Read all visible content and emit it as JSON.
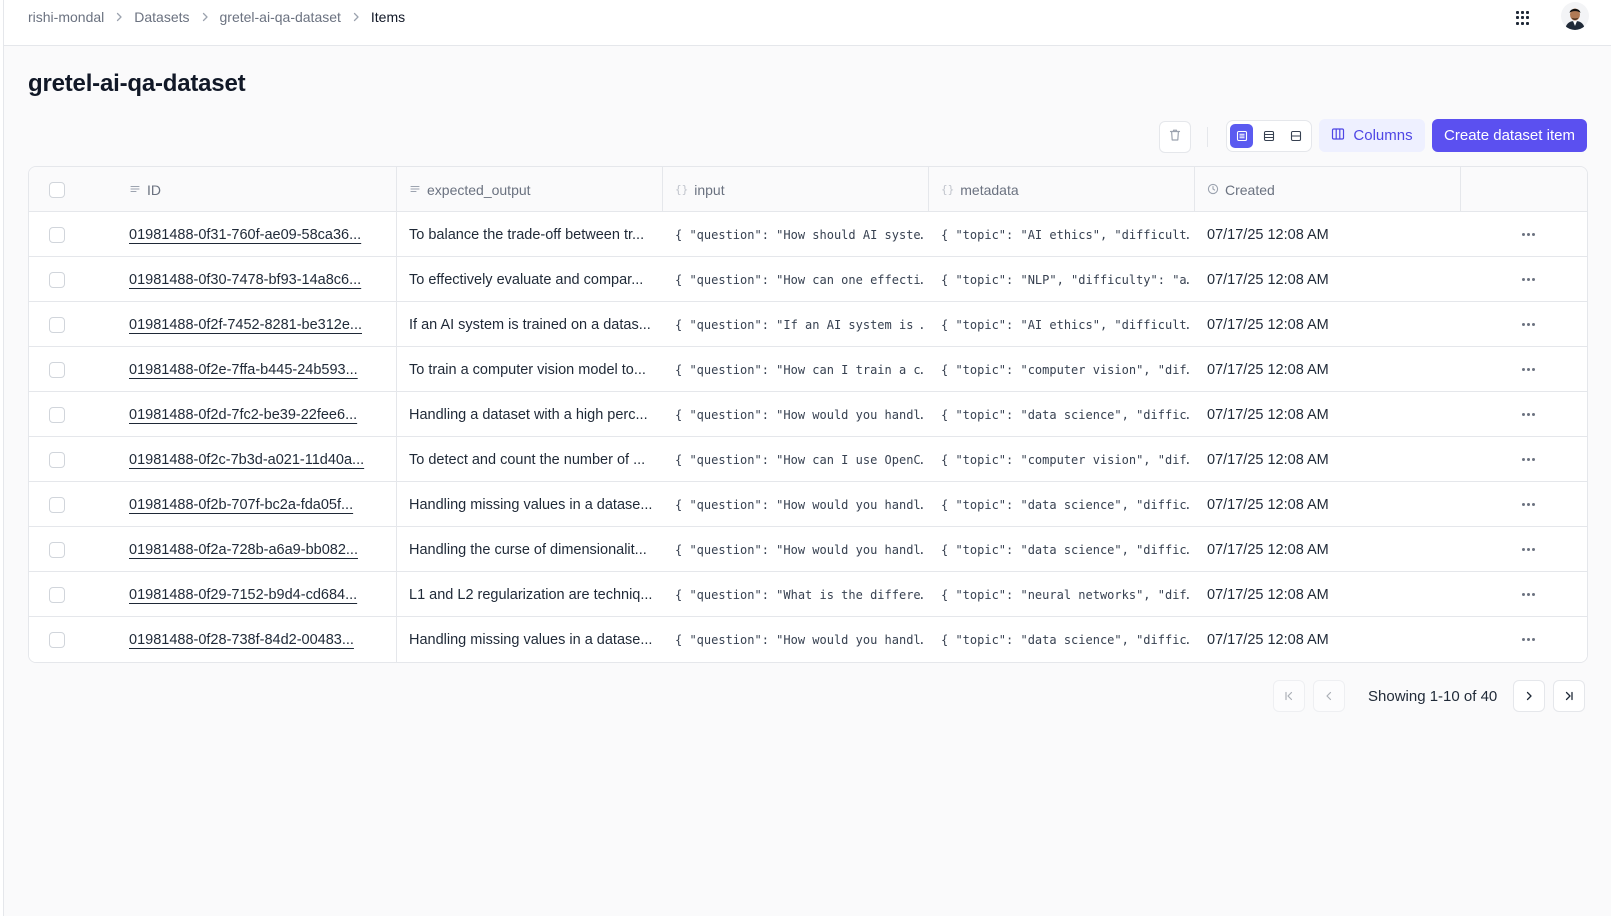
{
  "breadcrumb": {
    "items": [
      "rishi-mondal",
      "Datasets",
      "gretel-ai-qa-dataset",
      "Items"
    ]
  },
  "header": {
    "apps_icon": "grid-9-dots-icon",
    "avatar": "user-avatar"
  },
  "page": {
    "title": "gretel-ai-qa-dataset"
  },
  "toolbar": {
    "delete_icon": "trash-icon",
    "view_modes": [
      "rows-compact",
      "rows-medium",
      "rows-large"
    ],
    "active_view": "rows-compact",
    "columns_label": "Columns",
    "create_label": "Create dataset item"
  },
  "colors": {
    "accent": "#5b50f0",
    "accent_soft": "#eef0ff",
    "accent_text": "#4f46e5",
    "border": "#e5e7eb"
  },
  "table": {
    "headers": {
      "id": "ID",
      "expected_output": "expected_output",
      "input": "input",
      "metadata": "metadata",
      "created": "Created"
    },
    "rows": [
      {
        "id": "01981488-0f31-760f-ae09-58ca36...",
        "expected_output": "To balance the trade-off between tr...",
        "input": "{ \"question\": \"How should AI syste…",
        "metadata": "{ \"topic\": \"AI ethics\", \"difficult…",
        "created": "07/17/25 12:08 AM"
      },
      {
        "id": "01981488-0f30-7478-bf93-14a8c6...",
        "expected_output": "To effectively evaluate and compar...",
        "input": "{ \"question\": \"How can one effecti…",
        "metadata": "{ \"topic\": \"NLP\", \"difficulty\": \"a…",
        "created": "07/17/25 12:08 AM"
      },
      {
        "id": "01981488-0f2f-7452-8281-be312e...",
        "expected_output": "If an AI system is trained on a datas...",
        "input": "{ \"question\": \"If an AI system is …",
        "metadata": "{ \"topic\": \"AI ethics\", \"difficult…",
        "created": "07/17/25 12:08 AM"
      },
      {
        "id": "01981488-0f2e-7ffa-b445-24b593...",
        "expected_output": "To train a computer vision model to...",
        "input": "{ \"question\": \"How can I train a c…",
        "metadata": "{ \"topic\": \"computer vision\", \"dif…",
        "created": "07/17/25 12:08 AM"
      },
      {
        "id": "01981488-0f2d-7fc2-be39-22fee6...",
        "expected_output": "Handling a dataset with a high perc...",
        "input": "{ \"question\": \"How would you handl…",
        "metadata": "{ \"topic\": \"data science\", \"diffic…",
        "created": "07/17/25 12:08 AM"
      },
      {
        "id": "01981488-0f2c-7b3d-a021-11d40a...",
        "expected_output": "To detect and count the number of ...",
        "input": "{ \"question\": \"How can I use OpenC…",
        "metadata": "{ \"topic\": \"computer vision\", \"dif…",
        "created": "07/17/25 12:08 AM"
      },
      {
        "id": "01981488-0f2b-707f-bc2a-fda05f...",
        "expected_output": "Handling missing values in a datase...",
        "input": "{ \"question\": \"How would you handl…",
        "metadata": "{ \"topic\": \"data science\", \"diffic…",
        "created": "07/17/25 12:08 AM"
      },
      {
        "id": "01981488-0f2a-728b-a6a9-bb082...",
        "expected_output": "Handling the curse of dimensionalit...",
        "input": "{ \"question\": \"How would you handl…",
        "metadata": "{ \"topic\": \"data science\", \"diffic…",
        "created": "07/17/25 12:08 AM"
      },
      {
        "id": "01981488-0f29-7152-b9d4-cd684...",
        "expected_output": "L1 and L2 regularization are techniq...",
        "input": "{ \"question\": \"What is the differe…",
        "metadata": "{ \"topic\": \"neural networks\", \"dif…",
        "created": "07/17/25 12:08 AM"
      },
      {
        "id": "01981488-0f28-738f-84d2-00483...",
        "expected_output": "Handling missing values in a datase...",
        "input": "{ \"question\": \"How would you handl…",
        "metadata": "{ \"topic\": \"data science\", \"diffic…",
        "created": "07/17/25 12:08 AM"
      }
    ]
  },
  "pagination": {
    "label": "Showing 1-10 of 40",
    "first_disabled": true,
    "prev_disabled": true
  }
}
